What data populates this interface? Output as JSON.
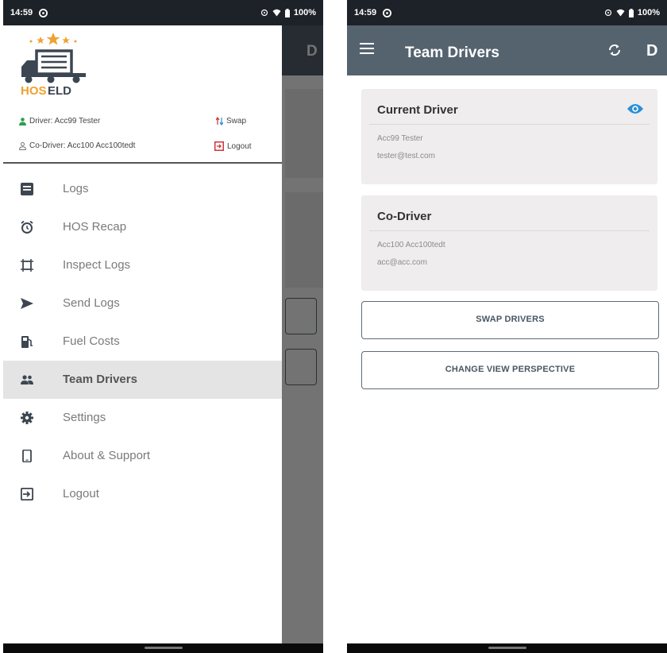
{
  "status_bar": {
    "time": "14:59",
    "battery": "100%"
  },
  "drawer": {
    "brand": {
      "word_a": "HOS",
      "word_b": "ELD"
    },
    "driver_label": "Driver: Acc99 Tester",
    "codriver_label": "Co-Driver: Acc100 Acc100tedt",
    "swap_label": "Swap",
    "logout_label": "Logout",
    "items": [
      {
        "label": "Logs",
        "icon": "logs-icon"
      },
      {
        "label": "HOS Recap",
        "icon": "alarm-clock-icon"
      },
      {
        "label": "Inspect Logs",
        "icon": "inspect-icon"
      },
      {
        "label": "Send Logs",
        "icon": "send-icon"
      },
      {
        "label": "Fuel Costs",
        "icon": "fuel-pump-icon"
      },
      {
        "label": "Team Drivers",
        "icon": "team-icon",
        "active": true
      },
      {
        "label": "Settings",
        "icon": "gear-icon"
      },
      {
        "label": "About & Support",
        "icon": "phone-icon"
      },
      {
        "label": "Logout",
        "icon": "logout-icon"
      }
    ]
  },
  "app_bar": {
    "title": "Team Drivers",
    "right_letter": "D"
  },
  "current_driver": {
    "title": "Current Driver",
    "name": "Acc99 Tester",
    "email": "tester@test.com"
  },
  "co_driver": {
    "title": "Co-Driver",
    "name": "Acc100 Acc100tedt",
    "email": "acc@acc.com"
  },
  "buttons": {
    "swap": "SWAP DRIVERS",
    "change_view": "CHANGE VIEW PERSPECTIVE"
  },
  "colors": {
    "app_bar": "#55636f",
    "accent_blue": "#2a8fd6",
    "driver_green": "#2e9e4f",
    "logout_red": "#d0343b",
    "brand_orange": "#f0a030"
  }
}
